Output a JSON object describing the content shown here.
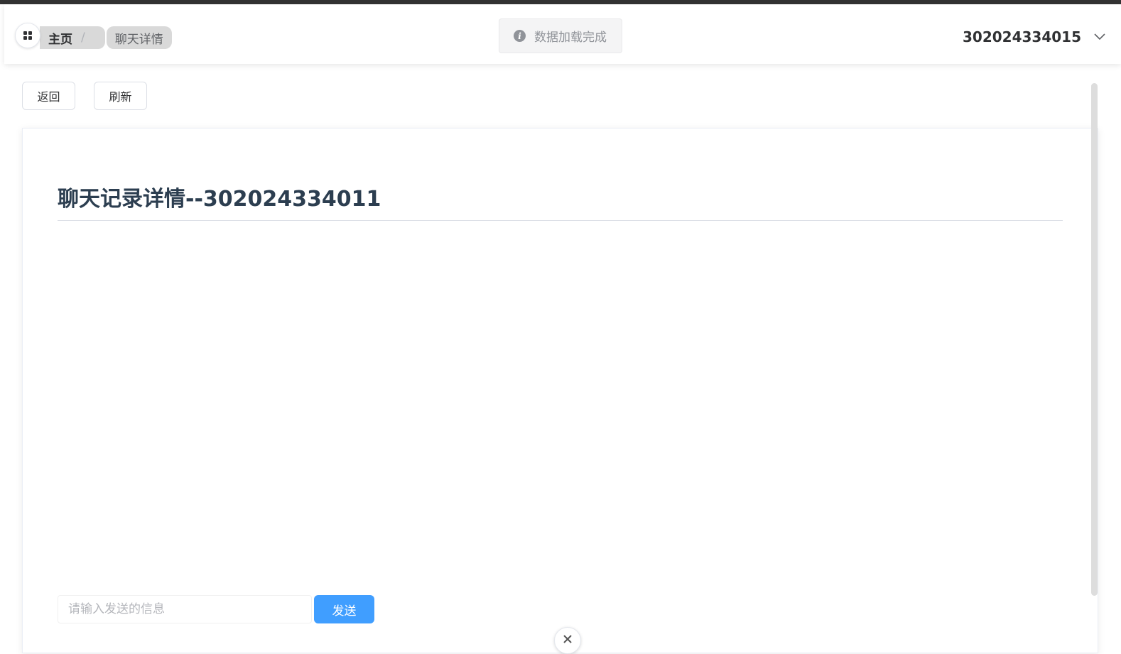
{
  "header": {
    "breadcrumb": {
      "home": "主页",
      "separator": "/",
      "current": "聊天详情"
    },
    "toast": {
      "icon": "info-icon",
      "message": "数据加载完成"
    },
    "user": {
      "name": "302024334015",
      "dropdown_icon": "chevron-down-icon"
    }
  },
  "toolbar": {
    "back_label": "返回",
    "refresh_label": "刷新"
  },
  "chat": {
    "title": "聊天记录详情--302024334011",
    "input_placeholder": "请输入发送的信息",
    "input_value": "",
    "send_label": "发送"
  },
  "colors": {
    "primary": "#409eff",
    "title": "#2c3e50",
    "top_strip": "#333333"
  }
}
